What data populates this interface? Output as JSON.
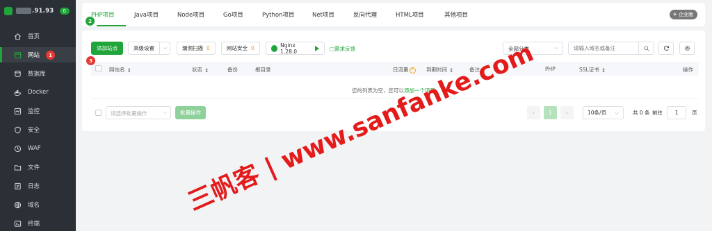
{
  "sidebar": {
    "ip": ".91.93",
    "badge": "0",
    "items": [
      {
        "label": "首页",
        "icon": "home-icon"
      },
      {
        "label": "网站",
        "icon": "globe-icon"
      },
      {
        "label": "数据库",
        "icon": "database-icon"
      },
      {
        "label": "Docker",
        "icon": "docker-icon"
      },
      {
        "label": "监控",
        "icon": "monitor-icon"
      },
      {
        "label": "安全",
        "icon": "shield-icon"
      },
      {
        "label": "WAF",
        "icon": "waf-icon"
      },
      {
        "label": "文件",
        "icon": "folder-icon"
      },
      {
        "label": "日志",
        "icon": "log-icon"
      },
      {
        "label": "域名",
        "icon": "domain-icon"
      },
      {
        "label": "终端",
        "icon": "terminal-icon"
      }
    ]
  },
  "annotations": [
    "1",
    "2",
    "3"
  ],
  "tabs": [
    "PHP项目",
    "Java项目",
    "Node项目",
    "Go项目",
    "Python项目",
    "Net项目",
    "反向代理",
    "HTML项目",
    "其他项目"
  ],
  "enterprise_label": "企业版",
  "toolbar": {
    "add_site": "添加站点",
    "advanced": "高级设置",
    "vuln_scan": "漏洞扫描",
    "vuln_count": "0",
    "site_security": "网站安全",
    "security_count": "0",
    "nginx": "Nginx 1.28.0",
    "feedback": "需求反馈",
    "category": "全部分类",
    "search_placeholder": "请输入域名或备注"
  },
  "table": {
    "headers": [
      "网站名",
      "状态",
      "备份",
      "根目录",
      "日流量",
      "到期时间",
      "备注",
      "PHP",
      "SSL证书",
      "操作"
    ],
    "empty_text": "您的列表为空，您可以",
    "empty_link": "添加一个项目"
  },
  "footer": {
    "batch_placeholder": "请选择批量操作",
    "batch_button": "批量操作",
    "current_page": "1",
    "page_size": "10条/页",
    "total": "共 0 条",
    "goto": "前往",
    "goto_value": "1",
    "page_suffix": "页"
  },
  "watermark": {
    "url": "www.sanfanke.com",
    "brand": "三帆客",
    "separator": "|"
  },
  "colors": {
    "accent": "#20a53a",
    "sidebar_bg": "#2b3036",
    "badge_red": "#e53935",
    "watermark": "#e31b1b"
  }
}
